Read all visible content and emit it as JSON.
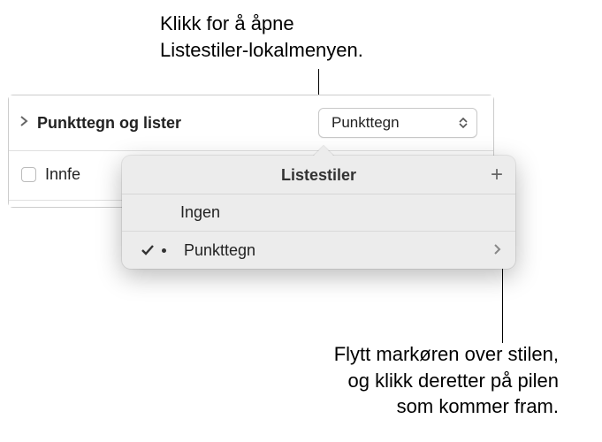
{
  "callouts": {
    "top_line1": "Klikk for å åpne",
    "top_line2": "Listestiler-lokalmenyen.",
    "bottom_line1": "Flytt markøren over stilen,",
    "bottom_line2": "og klikk deretter på pilen",
    "bottom_line3": "som kommer fram."
  },
  "panel": {
    "section_title": "Punkttegn og lister",
    "style_button_label": "Punkttegn",
    "truncated_label": "Innfe"
  },
  "popover": {
    "title": "Listestiler",
    "add_symbol": "+",
    "items": [
      {
        "label": "Ingen",
        "selected": false,
        "has_bullet": false
      },
      {
        "label": "Punkttegn",
        "selected": true,
        "has_bullet": true
      }
    ]
  }
}
